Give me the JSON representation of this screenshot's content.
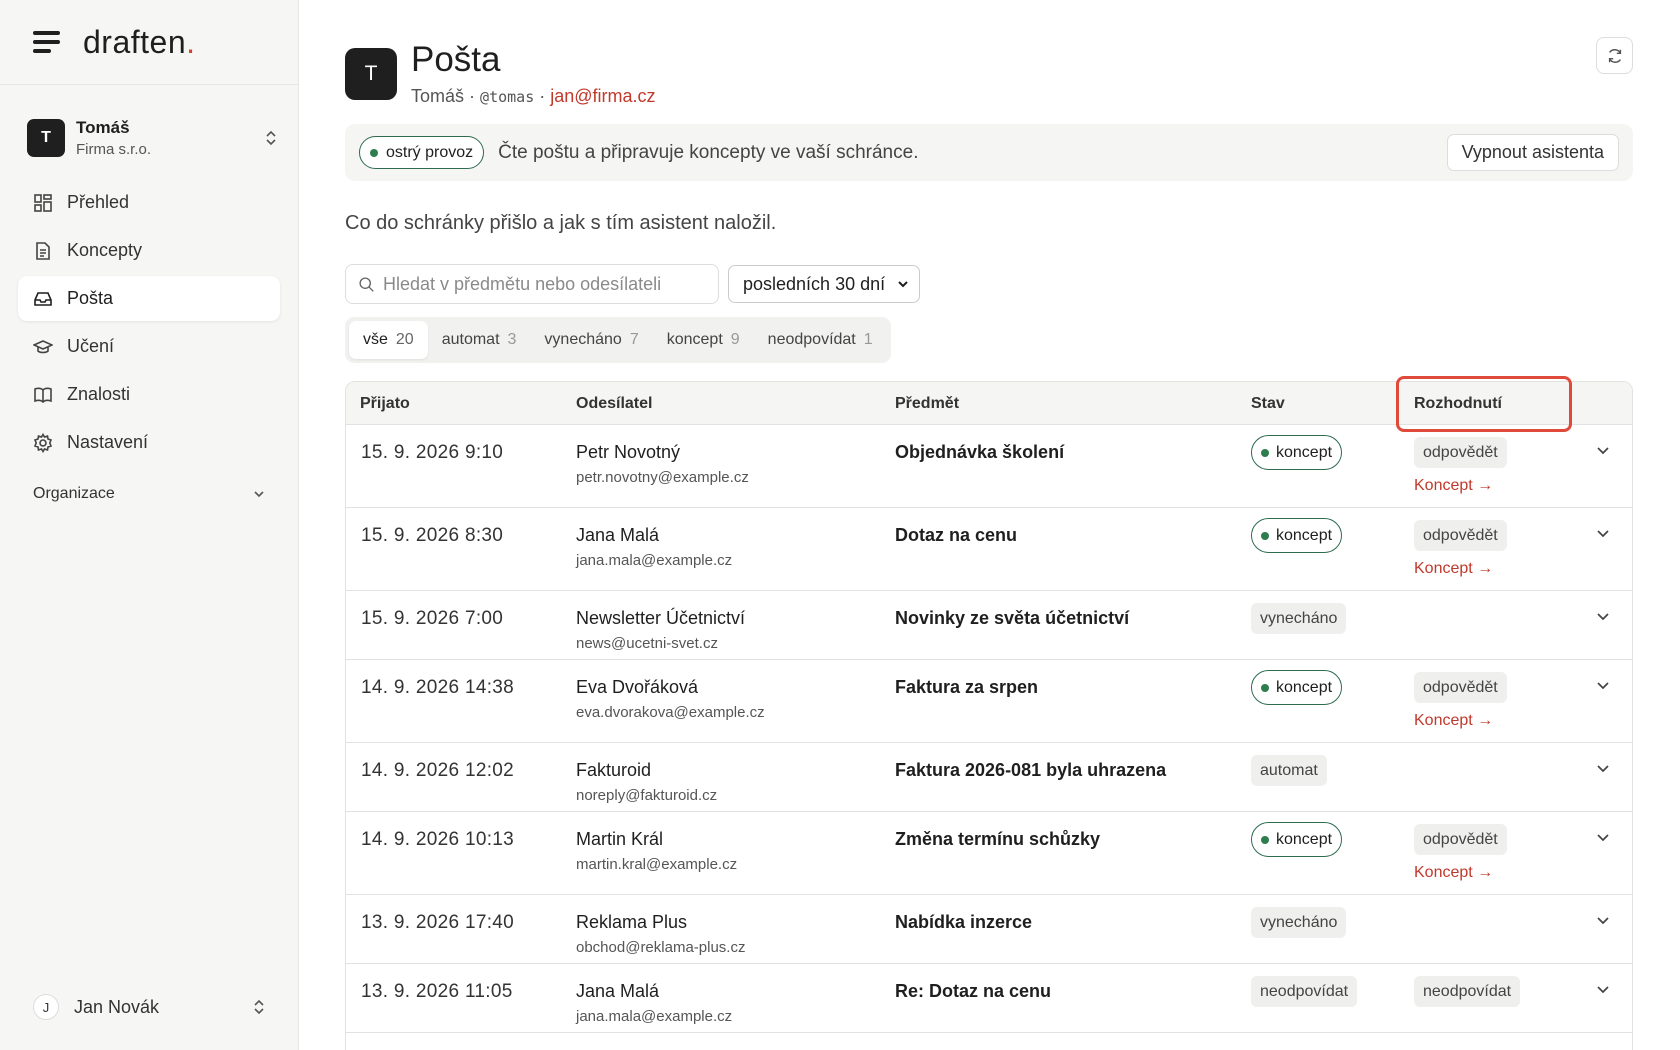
{
  "brand": {
    "name": "draften",
    "dot": "."
  },
  "account": {
    "initial": "T",
    "name": "Tomáš",
    "org": "Firma s.r.o."
  },
  "nav": [
    {
      "label": "Přehled",
      "icon": "dashboard-icon"
    },
    {
      "label": "Koncepty",
      "icon": "document-icon"
    },
    {
      "label": "Pošta",
      "icon": "inbox-icon"
    },
    {
      "label": "Učení",
      "icon": "graduation-cap-icon"
    },
    {
      "label": "Znalosti",
      "icon": "book-icon"
    },
    {
      "label": "Nastavení",
      "icon": "gear-icon"
    }
  ],
  "organization": {
    "label": "Organizace"
  },
  "user": {
    "initial": "J",
    "name": "Jan Novák"
  },
  "header": {
    "initial": "T",
    "title": "Pošta",
    "name": "Tomáš",
    "sep": "·",
    "handle": "@tomas",
    "email": "jan@firma.cz"
  },
  "banner": {
    "badge": "ostrý provoz",
    "text": "Čte poštu a připravuje koncepty ve vaší schránce.",
    "button": "Vypnout asistenta"
  },
  "intro": "Co do schránky přišlo a jak s tím asistent naložil.",
  "search": {
    "placeholder": "Hledat v předmětu nebo odesílateli"
  },
  "period": {
    "selected": "posledních 30 dní"
  },
  "filters": [
    {
      "label": "vše",
      "count": "20"
    },
    {
      "label": "automat",
      "count": "3"
    },
    {
      "label": "vynecháno",
      "count": "7"
    },
    {
      "label": "koncept",
      "count": "9"
    },
    {
      "label": "neodpovídat",
      "count": "1"
    }
  ],
  "table": {
    "headers": {
      "date": "Přijato",
      "sender": "Odesílatel",
      "subject": "Předmět",
      "status": "Stav",
      "decision": "Rozhodnutí"
    },
    "link_label": "Koncept →",
    "rows": [
      {
        "date": "15. 9. 2026 9:10",
        "name": "Petr Novotný",
        "email": "petr.novotny@example.cz",
        "subject": "Objednávka školení",
        "status": "koncept",
        "decision": "odpovědět",
        "link": true
      },
      {
        "date": "15. 9. 2026 8:30",
        "name": "Jana Malá",
        "email": "jana.mala@example.cz",
        "subject": "Dotaz na cenu",
        "status": "koncept",
        "decision": "odpovědět",
        "link": true
      },
      {
        "date": "15. 9. 2026 7:00",
        "name": "Newsletter Účetnictví",
        "email": "news@ucetni-svet.cz",
        "subject": "Novinky ze světa účetnictví",
        "status": "vynecháno",
        "decision": "",
        "link": false
      },
      {
        "date": "14. 9. 2026 14:38",
        "name": "Eva Dvořáková",
        "email": "eva.dvorakova@example.cz",
        "subject": "Faktura za srpen",
        "status": "koncept",
        "decision": "odpovědět",
        "link": true
      },
      {
        "date": "14. 9. 2026 12:02",
        "name": "Fakturoid",
        "email": "noreply@fakturoid.cz",
        "subject": "Faktura 2026-081 byla uhrazena",
        "status": "automat",
        "decision": "",
        "link": false
      },
      {
        "date": "14. 9. 2026 10:13",
        "name": "Martin Král",
        "email": "martin.kral@example.cz",
        "subject": "Změna termínu schůzky",
        "status": "koncept",
        "decision": "odpovědět",
        "link": true
      },
      {
        "date": "13. 9. 2026 17:40",
        "name": "Reklama Plus",
        "email": "obchod@reklama-plus.cz",
        "subject": "Nabídka inzerce",
        "status": "vynecháno",
        "decision": "",
        "link": false
      },
      {
        "date": "13. 9. 2026 11:05",
        "name": "Jana Malá",
        "email": "jana.mala@example.cz",
        "subject": "Re: Dotaz na cenu",
        "status": "neodpovídat",
        "decision": "neodpovídat",
        "link": false
      }
    ]
  },
  "colors": {
    "accent": "#c0392b",
    "success": "#2e7d4f",
    "highlight": "#e04a3a"
  }
}
